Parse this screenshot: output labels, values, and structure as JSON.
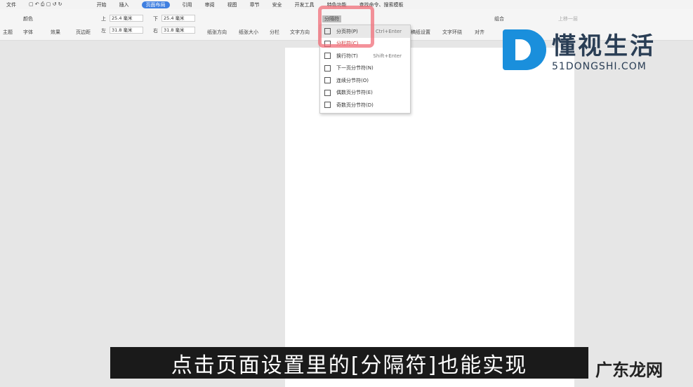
{
  "quickbar": {
    "file": "文件",
    "tabs": [
      "开始",
      "插入",
      "页面布局",
      "引用",
      "审阅",
      "视图",
      "章节",
      "安全",
      "开发工具",
      "特色功能"
    ],
    "search": "查找命令、搜索模板"
  },
  "ribbon": {
    "theme": "主题",
    "color": "颜色",
    "font": "字体",
    "effect": "效果",
    "margin": "页边距",
    "top_label": "上",
    "top_val": "25.4 毫米",
    "bottom_label": "下",
    "bottom_val": "25.4 毫米",
    "left_label": "左",
    "left_val": "31.8 毫米",
    "right_label": "右",
    "right_val": "31.8 毫米",
    "orientation": "纸张方向",
    "size": "纸张大小",
    "columns": "分栏",
    "text_dir": "文字方向",
    "breaks": "分隔符",
    "paper_setup": "稿纸设置",
    "wrap": "文字环绕",
    "align": "对齐",
    "group": "组合",
    "prev": "上移一层"
  },
  "menu": [
    {
      "label": "分页符(P)",
      "key": "Ctrl+Enter"
    },
    {
      "label": "分栏符(C)",
      "key": ""
    },
    {
      "label": "换行符(T)",
      "key": "Shift+Enter"
    },
    {
      "label": "下一页分节符(N)",
      "key": ""
    },
    {
      "label": "连续分节符(O)",
      "key": ""
    },
    {
      "label": "偶数页分节符(E)",
      "key": ""
    },
    {
      "label": "奇数页分节符(D)",
      "key": ""
    }
  ],
  "subtitle": "点击页面设置里的[分隔符]也能实现",
  "logo": {
    "name": "懂视生活",
    "domain": "51DONGSHI.COM"
  },
  "watermark": "广东龙网"
}
